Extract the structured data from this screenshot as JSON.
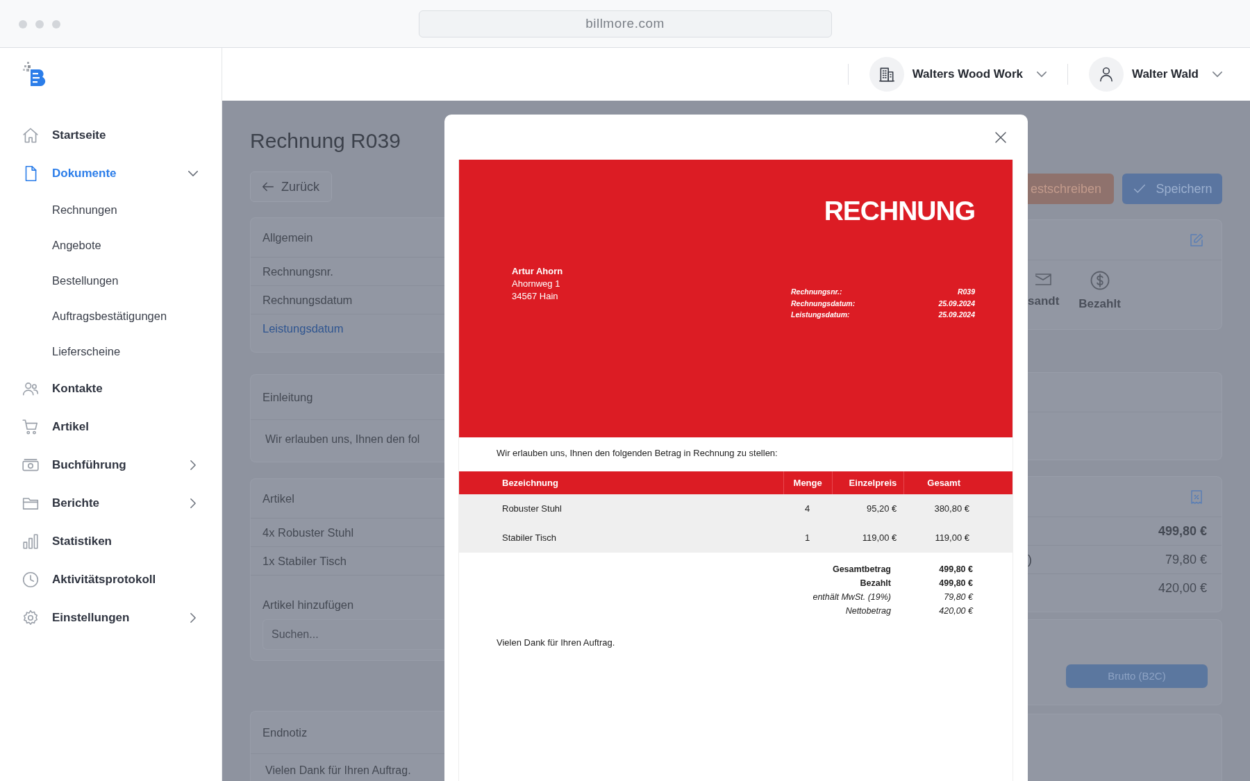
{
  "browser": {
    "url": "billmore.com"
  },
  "sidebar": {
    "items": [
      {
        "label": "Startseite",
        "selected": false
      },
      {
        "label": "Dokumente",
        "selected": true,
        "expanded": true,
        "children": [
          {
            "label": "Rechnungen",
            "selected": false
          },
          {
            "label": "Angebote",
            "selected": false
          },
          {
            "label": "Bestellungen",
            "selected": false
          },
          {
            "label": "Auftragsbestätigungen",
            "selected": false
          },
          {
            "label": "Lieferscheine",
            "selected": false
          }
        ]
      },
      {
        "label": "Kontakte",
        "selected": false
      },
      {
        "label": "Artikel",
        "selected": false
      },
      {
        "label": "Buchführung",
        "selected": false,
        "expanded": false
      },
      {
        "label": "Berichte",
        "selected": false,
        "expanded": false
      },
      {
        "label": "Statistiken",
        "selected": false
      },
      {
        "label": "Aktivitätsprotokoll",
        "selected": false
      },
      {
        "label": "Einstellungen",
        "selected": false,
        "expanded": false
      }
    ]
  },
  "topbar": {
    "company": "Walters Wood Work",
    "user": "Walter Wald"
  },
  "page": {
    "title": "Rechnung R039",
    "back_button": "Zurück",
    "actions": [
      {
        "label": "estschreiben",
        "kind": "danger"
      },
      {
        "label": "Speichern",
        "kind": "primary"
      }
    ],
    "general": {
      "heading": "Allgemein",
      "rows": [
        {
          "label": "Rechnungsnr.",
          "selected": false
        },
        {
          "label": "Rechnungsdatum",
          "selected": false
        },
        {
          "label": "Leistungsdatum",
          "selected": true
        }
      ]
    },
    "status": [
      {
        "label": "sandt"
      },
      {
        "label": "Bezahlt"
      }
    ],
    "intro": {
      "heading": "Einleitung",
      "text": "Wir erlauben uns, Ihnen den fol"
    },
    "articles": {
      "heading": "Artikel",
      "items": [
        "4x Robuster Stuhl",
        "1x Stabiler Tisch"
      ],
      "add_label": "Artikel hinzufügen",
      "search_placeholder": "Suchen..."
    },
    "summary": [
      {
        "value": "499,80 €",
        "kind": "bold"
      },
      {
        "label": ")",
        "value": "79,80 €",
        "kind": "regular"
      },
      {
        "value": "420,00 €",
        "kind": "regular"
      }
    ],
    "tax_mode_button": "Brutto (B2C)",
    "end_note": {
      "heading": "Endnotiz",
      "text": "Vielen Dank für Ihren Auftrag."
    }
  },
  "modal": {
    "document": {
      "title": "RECHNUNG",
      "recipient": {
        "name": "Artur Ahorn",
        "street": "Ahornweg 1",
        "city": "34567 Hain"
      },
      "meta": [
        {
          "label": "Rechnungsnr.:",
          "value": "R039"
        },
        {
          "label": "Rechnungsdatum:",
          "value": "25.09.2024"
        },
        {
          "label": "Leistungsdatum:",
          "value": "25.09.2024"
        }
      ],
      "intro": "Wir erlauben uns, Ihnen den folgenden Betrag in Rechnung zu stellen:",
      "table": {
        "columns": [
          "Bezeichnung",
          "Menge",
          "Einzelpreis",
          "Gesamt"
        ],
        "rows": [
          [
            "Robuster Stuhl",
            "4",
            "95,20 €",
            "380,80 €"
          ],
          [
            "Stabiler Tisch",
            "1",
            "119,00 €",
            "119,00 €"
          ]
        ]
      },
      "totals": [
        {
          "label": "Gesamtbetrag",
          "value": "499,80 €",
          "kind": "bold"
        },
        {
          "label": "Bezahlt",
          "value": "499,80 €",
          "kind": "bold"
        },
        {
          "label": "enthält MwSt. (19%)",
          "value": "79,80 €",
          "kind": "italic"
        },
        {
          "label": "Nettobetrag",
          "value": "420,00 €",
          "kind": "italic"
        }
      ],
      "closing": "Vielen Dank für Ihren Auftrag."
    }
  }
}
